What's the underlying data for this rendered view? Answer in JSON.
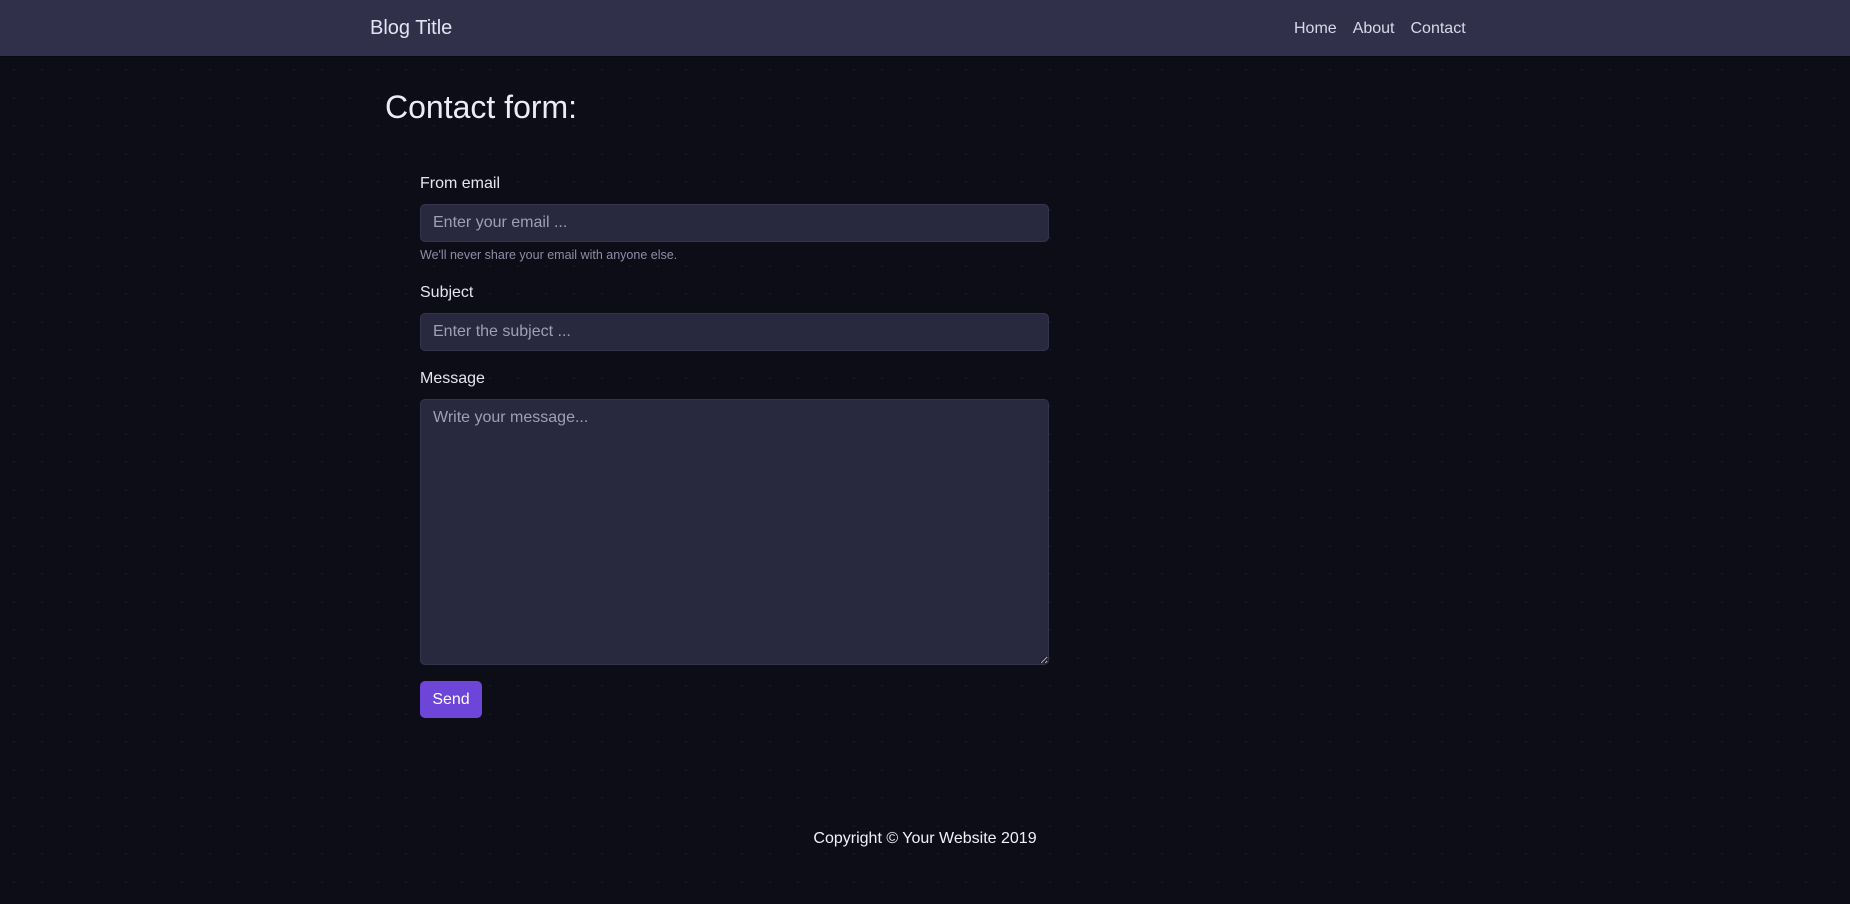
{
  "navbar": {
    "brand": "Blog Title",
    "links": [
      "Home",
      "About",
      "Contact"
    ]
  },
  "page": {
    "title": "Contact form:"
  },
  "form": {
    "email": {
      "label": "From email",
      "placeholder": "Enter your email ...",
      "value": "",
      "help": "We'll never share your email with anyone else."
    },
    "subject": {
      "label": "Subject",
      "placeholder": "Enter the subject ...",
      "value": ""
    },
    "message": {
      "label": "Message",
      "placeholder": "Write your message...",
      "value": ""
    },
    "submit_label": "Send"
  },
  "footer": {
    "copyright": "Copyright © Your Website 2019"
  },
  "colors": {
    "background": "#0d0d18",
    "navbar": "#30304a",
    "field": "#28283e",
    "accent": "#6d46d9"
  }
}
